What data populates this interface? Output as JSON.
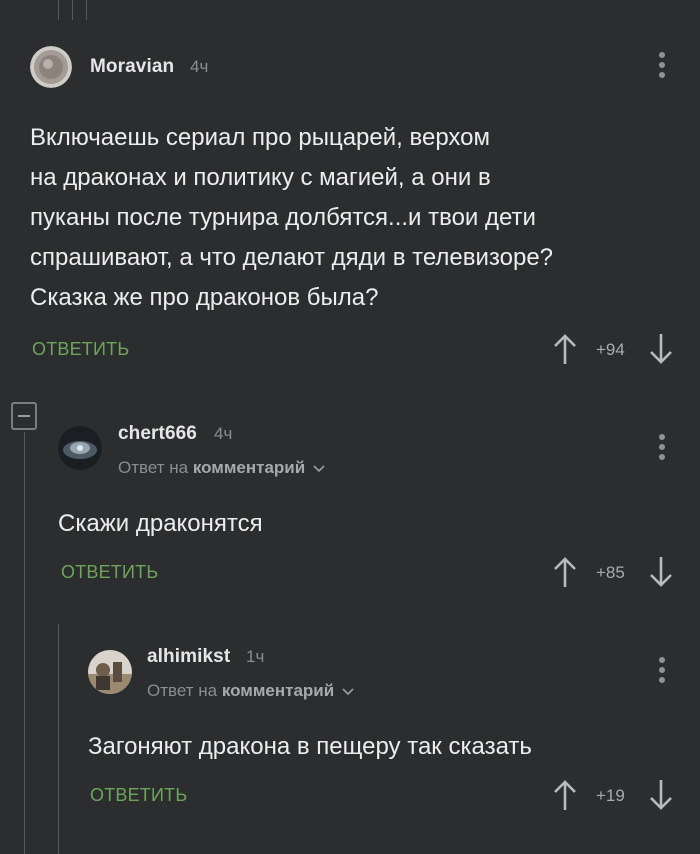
{
  "comments": [
    {
      "username": "Moravian",
      "time": "4ч",
      "text": [
        "Включаешь сериал про рыцарей, верхом",
        "на драконах и политику с магией, а они в",
        "пуканы после турнира долбятся...и твои дети",
        "спрашивают, а что делают дяди в телевизоре?",
        "Сказка же про драконов была?"
      ],
      "reply_label": "ОТВЕТИТЬ",
      "score": "+94"
    },
    {
      "username": "chert666",
      "time": "4ч",
      "reply_to_prefix": "Ответ на",
      "reply_to_target": "комментарий",
      "text": [
        "Скажи драконятся"
      ],
      "reply_label": "ОТВЕТИТЬ",
      "score": "+85"
    },
    {
      "username": "alhimikst",
      "time": "1ч",
      "reply_to_prefix": "Ответ на",
      "reply_to_target": "комментарий",
      "text": [
        "Загоняют дракона в пещеру так сказать"
      ],
      "reply_label": "ОТВЕТИТЬ",
      "score": "+19"
    }
  ],
  "colors": {
    "background": "#2b2d2f",
    "reply_accent": "#6ea55b",
    "muted": "#8a8d91"
  }
}
